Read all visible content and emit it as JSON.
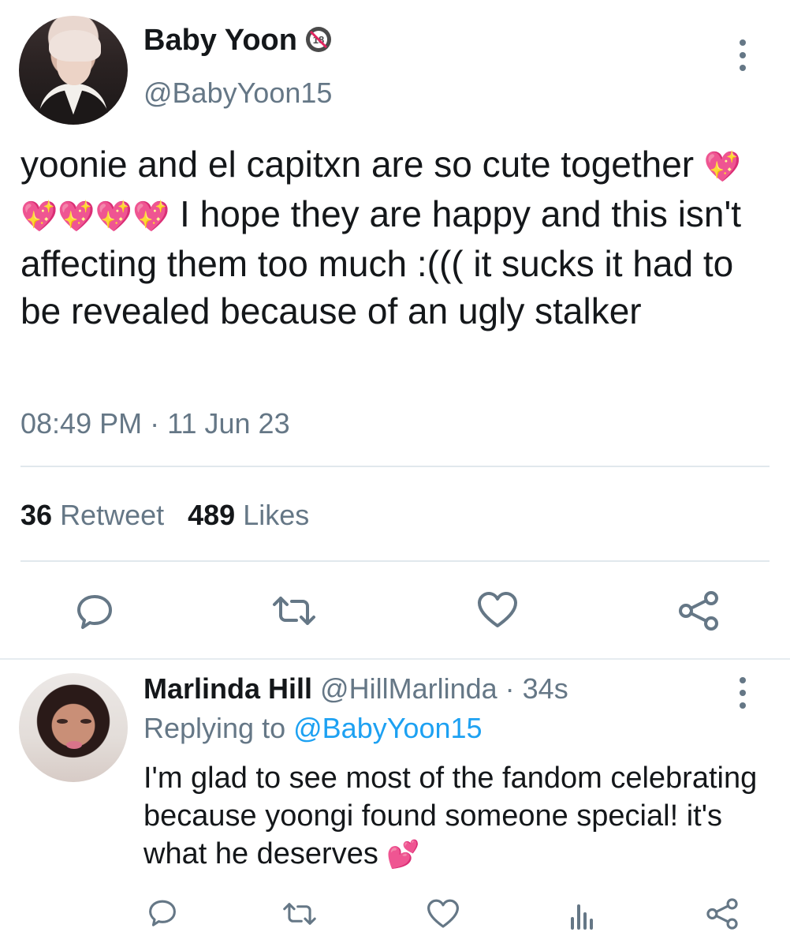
{
  "main_tweet": {
    "author_name": "Baby Yoon",
    "badge": "18-restricted-badge-icon",
    "handle": "@BabyYoon15",
    "text_part1": "yoonie and el capitxn are so cute together ",
    "emoji_run": "💖💖💖💖💖",
    "text_part2": " I hope they are happy and this isn't affecting them too much :((( it sucks it had to be revealed because of an ugly stalker",
    "time": "08:49 PM",
    "date_sep": "·",
    "date": "11 Jun 23",
    "retweet_count": "36",
    "retweet_label": "Retweet",
    "likes_count": "489",
    "likes_label": "Likes",
    "actions": [
      "reply-icon",
      "retweet-icon",
      "like-icon",
      "share-icon"
    ]
  },
  "reply_tweet": {
    "author_name": "Marlinda Hill",
    "handle": "@HillMarlinda",
    "sep": " · ",
    "age": "34s",
    "replying_label": "Replying to",
    "replying_to": "@BabyYoon15",
    "text": "I'm glad to see most of the fandom celebrating because yoongi found someone special! it's what he deserves",
    "emoji": "💕",
    "actions": [
      "reply-icon",
      "retweet-icon",
      "like-icon",
      "analytics-icon",
      "share-icon"
    ]
  },
  "colors": {
    "text": "#14171a",
    "muted": "#657786",
    "link": "#1da1f2",
    "divider": "#e1e8ed",
    "emoji_pink": "#f13d9b"
  }
}
